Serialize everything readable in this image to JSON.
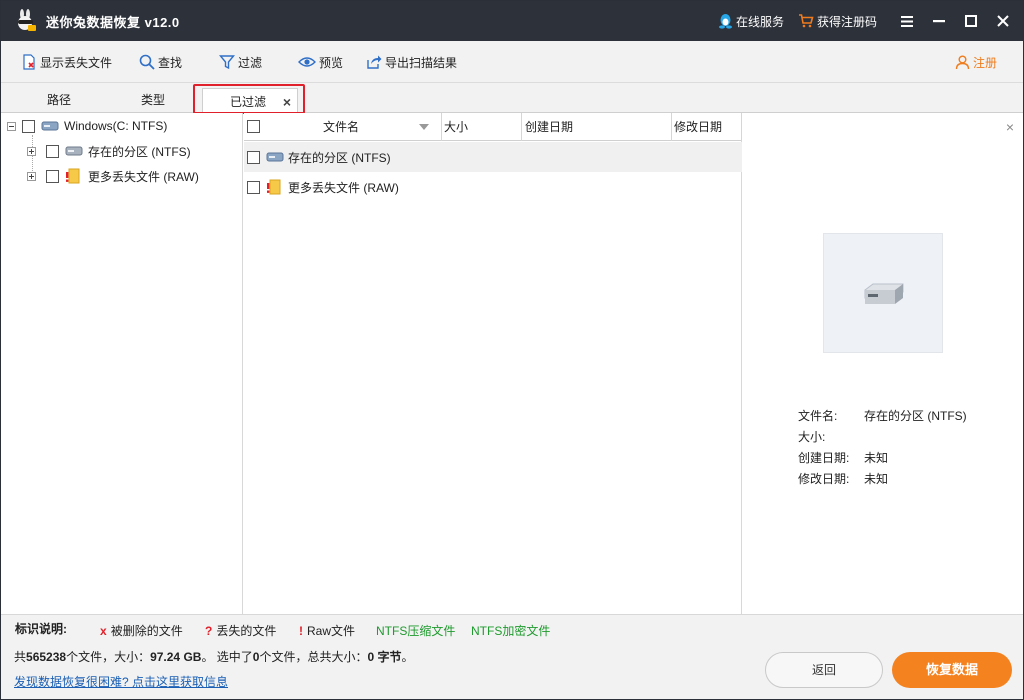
{
  "window": {
    "title": "迷你兔数据恢复 v12.0",
    "online_service": "在线服务",
    "get_code": "获得注册码"
  },
  "toolbar": {
    "show_lost": "显示丢失文件",
    "find": "查找",
    "filter": "过滤",
    "preview": "预览",
    "export": "导出扫描结果",
    "register": "注册"
  },
  "tabs": {
    "path": "路径",
    "type": "类型",
    "filtered": "已过滤",
    "close": "×"
  },
  "tree": {
    "root": "Windows(C: NTFS)",
    "children": [
      "存在的分区 (NTFS)",
      "更多丢失文件 (RAW)"
    ]
  },
  "list": {
    "columns": [
      "文件名",
      "大小",
      "创建日期",
      "修改日期"
    ],
    "rows": [
      "存在的分区 (NTFS)",
      "更多丢失文件 (RAW)"
    ]
  },
  "preview": {
    "close": "×",
    "name_label": "文件名:",
    "name_value": "存在的分区 (NTFS)",
    "size_label": "大小:",
    "size_value": "",
    "created_label": "创建日期:",
    "created_value": "未知",
    "modified_label": "修改日期:",
    "modified_value": "未知"
  },
  "legend": {
    "label": "标识说明:",
    "deleted_mark": "x",
    "deleted": "被删除的文件",
    "lost_mark": "?",
    "lost": "丢失的文件",
    "raw_mark": "!",
    "raw": "Raw文件",
    "ntfs_compressed": "NTFS压缩文件",
    "ntfs_encrypted": "NTFS加密文件"
  },
  "status": {
    "prefix": "共",
    "total_files": "565238",
    "files_size_label": "个文件，大小：",
    "total_size": "97.24 GB",
    "selected_prefix": "。 选中了",
    "selected_count": "0",
    "selected_suffix": "个文件，总共大小：",
    "selected_size": "0 字节",
    "end": "。",
    "help_link": "发现数据恢复很困难? 点击这里获取信息",
    "back": "返回",
    "recover": "恢复数据"
  },
  "colors": {
    "titlebar": "#2d313a",
    "accent_orange": "#f4821f",
    "highlight_red": "#e0202a",
    "legend_red": "#e0202a",
    "legend_green": "#1f9a2e",
    "link_blue": "#1a5fb4"
  }
}
